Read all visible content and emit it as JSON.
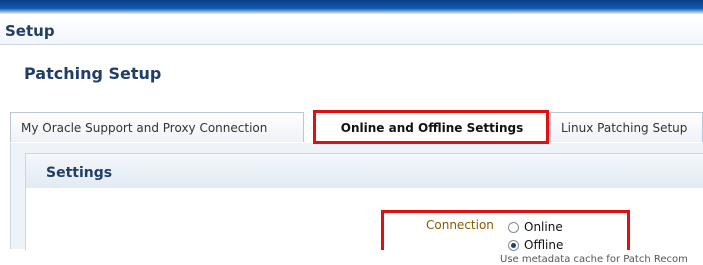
{
  "header": {
    "title": "Setup"
  },
  "page": {
    "title": "Patching Setup"
  },
  "tabs": [
    {
      "label": "My Oracle Support and Proxy Connection"
    },
    {
      "label": "Online and Offline Settings"
    },
    {
      "label": "Linux Patching Setup"
    }
  ],
  "settings": {
    "title": "Settings",
    "connection": {
      "label": "Connection",
      "options": [
        {
          "label": "Online",
          "selected": false
        },
        {
          "label": "Offline",
          "selected": true
        }
      ],
      "hint": "Use metadata cache for Patch Recom"
    }
  },
  "colors": {
    "highlight": "#e01010",
    "heading": "#1f3f66",
    "label": "#8a5a00"
  }
}
